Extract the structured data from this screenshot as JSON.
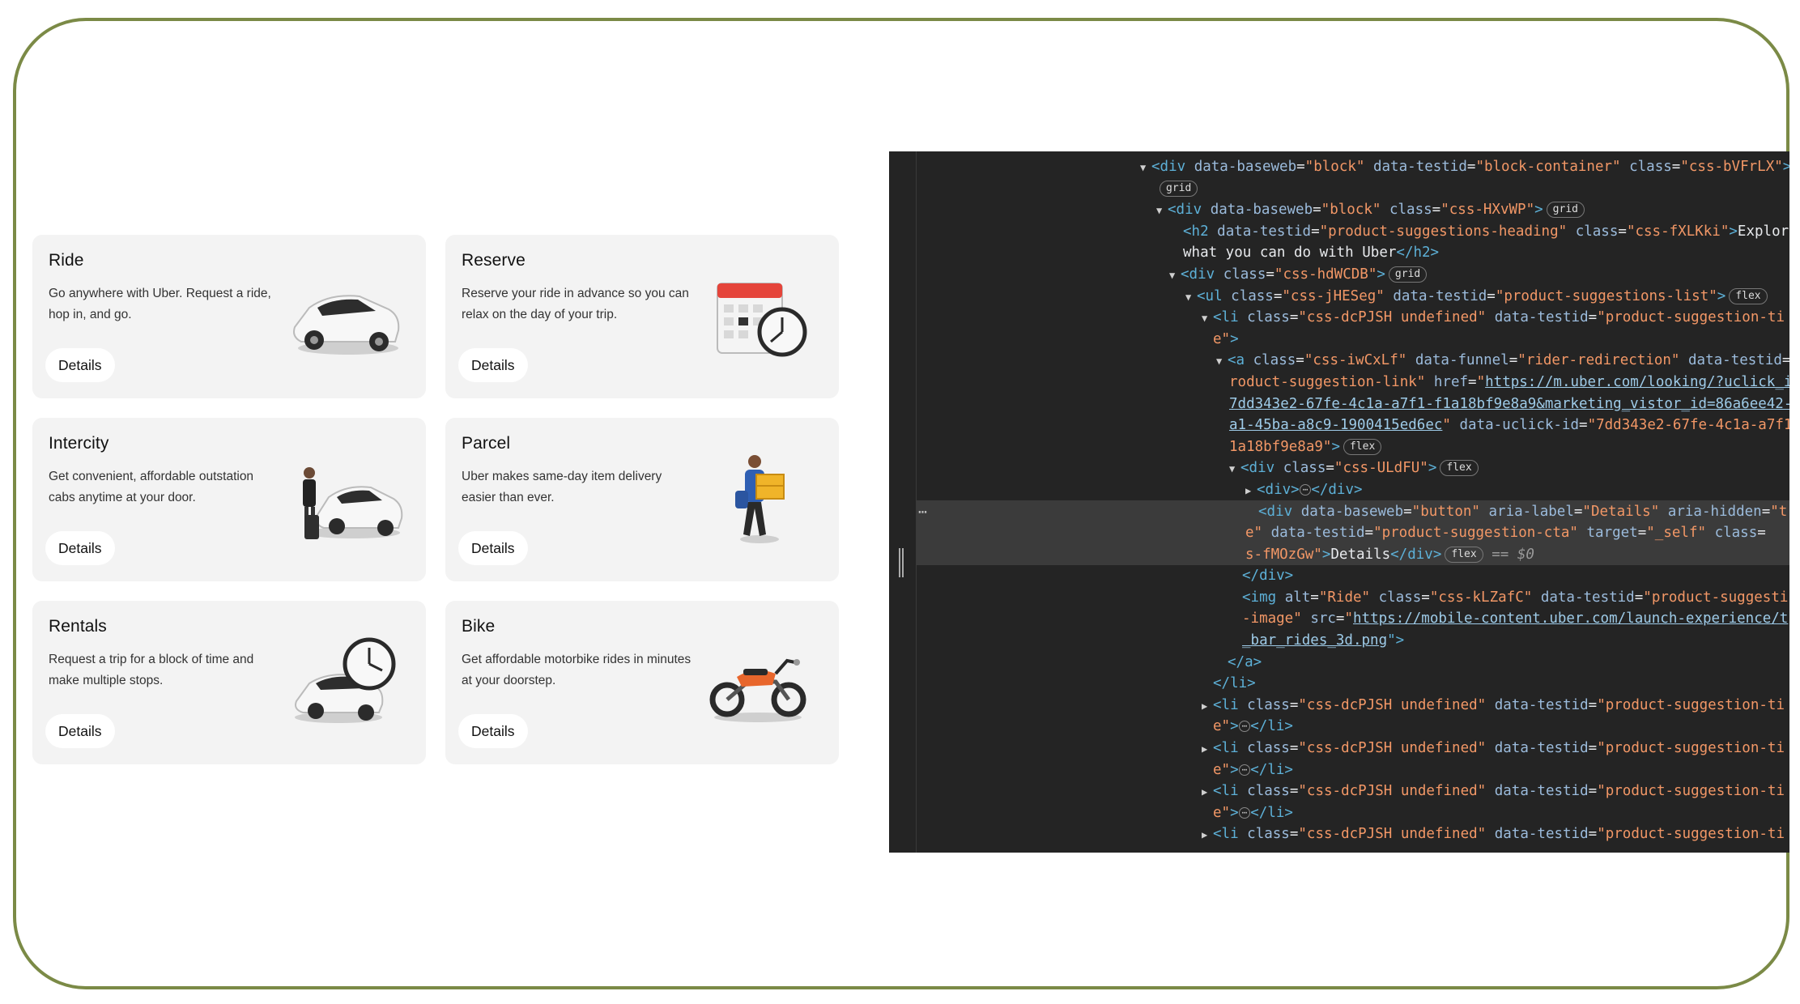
{
  "cards": [
    {
      "title": "Ride",
      "desc": "Go anywhere with Uber. Request a ride, hop in, and go.",
      "button": "Details",
      "icon": "car-icon"
    },
    {
      "title": "Reserve",
      "desc": "Reserve your ride in advance so you can relax on the day of your trip.",
      "button": "Details",
      "icon": "calendar-clock-icon"
    },
    {
      "title": "Intercity",
      "desc": "Get convenient, affordable outstation cabs anytime at your door.",
      "button": "Details",
      "icon": "traveler-car-icon"
    },
    {
      "title": "Parcel",
      "desc": "Uber makes same-day item delivery easier than ever.",
      "button": "Details",
      "icon": "courier-box-icon"
    },
    {
      "title": "Rentals",
      "desc": "Request a trip for a block of time and make multiple stops.",
      "button": "Details",
      "icon": "car-clock-icon"
    },
    {
      "title": "Bike",
      "desc": "Get affordable motorbike rides in minutes at your doorstep.",
      "button": "Details",
      "icon": "motorbike-icon"
    }
  ],
  "devtools": {
    "l1": {
      "tag_open": "<div ",
      "a1": "data-baseweb",
      "v1": "\"block\"",
      "a2": "data-testid",
      "v2": "\"block-container\"",
      "a3": "class",
      "v3": "\"css-bVFrLX\"",
      "close": ">"
    },
    "l2": {
      "badge": "grid"
    },
    "l3": {
      "tag_open": "<div ",
      "a1": "data-baseweb",
      "v1": "\"block\"",
      "a2": "class",
      "v2": "\"css-HXvWP\"",
      "close": ">",
      "badge": "grid"
    },
    "l4": {
      "tag_open": "<h2 ",
      "a1": "data-testid",
      "v1": "\"product-suggestions-heading\"",
      "a2": "class",
      "v2": "\"css-fXLKki\"",
      "close": ">",
      "text": "Explore"
    },
    "l5": {
      "text": "what you can do with Uber",
      "tag_close": "</h2>"
    },
    "l6": {
      "tag_open": "<div ",
      "a1": "class",
      "v1": "\"css-hdWCDB\"",
      "close": ">",
      "badge": "grid"
    },
    "l7": {
      "tag_open": "<ul ",
      "a1": "class",
      "v1": "\"css-jHESeg\"",
      "a2": "data-testid",
      "v2": "\"product-suggestions-list\"",
      "close": ">",
      "badge": "flex"
    },
    "l8": {
      "tag_open": "<li ",
      "a1": "class",
      "v1": "\"css-dcPJSH undefined\"",
      "a2": "data-testid",
      "v2": "\"product-suggestion-ti"
    },
    "l9": {
      "v": "e\"",
      "close": ">"
    },
    "l10": {
      "tag_open": "<a ",
      "a1": "class",
      "v1": "\"css-iwCxLf\"",
      "a2": "data-funnel",
      "v2": "\"rider-redirection\"",
      "a3": "data-testid"
    },
    "l11": {
      "v": "roduct-suggestion-link\"",
      "a1": "href",
      "link": "https://m.uber.com/looking/?uclick_i"
    },
    "l12": {
      "link": "7dd343e2-67fe-4c1a-a7f1-f1a18bf9e8a9&marketing_vistor_id=86a6ee42-"
    },
    "l13": {
      "link": "a1-45ba-a8c9-1900415ed6ec",
      "a1": "data-uclick-id",
      "v1": "\"7dd343e2-67fe-4c1a-a7f1"
    },
    "l14": {
      "v": "1a18bf9e8a9\"",
      "close": ">",
      "badge": "flex"
    },
    "l15": {
      "tag_open": "<div ",
      "a1": "class",
      "v1": "\"css-ULdFU\"",
      "close": ">",
      "badge": "flex"
    },
    "l16": {
      "tag_open": "<div>",
      "ellipsis": "⋯",
      "tag_close": "</div>"
    },
    "l17": {
      "tag_open": "<div ",
      "a1": "data-baseweb",
      "v1": "\"button\"",
      "a2": "aria-label",
      "v2": "\"Details\"",
      "a3": "aria-hidden",
      "v3": "\"t"
    },
    "l18": {
      "v": "e\"",
      "a1": "data-testid",
      "v1": "\"product-suggestion-cta\"",
      "a2": "target",
      "v2": "\"_self\"",
      "a3": "class"
    },
    "l19": {
      "v": "s-fMOzGw\"",
      "close": ">",
      "text": "Details",
      "tag_close": "</div>",
      "badge": "flex",
      "ref": "== $0"
    },
    "l20": {
      "tag_close": "</div>"
    },
    "l21": {
      "tag_open": "<img ",
      "a1": "alt",
      "v1": "\"Ride\"",
      "a2": "class",
      "v2": "\"css-kLZafC\"",
      "a3": "data-testid",
      "v3": "\"product-suggesti"
    },
    "l22": {
      "v": "-image\"",
      "a1": "src",
      "link": "https://mobile-content.uber.com/launch-experience/t"
    },
    "l23": {
      "link": "_bar_rides_3d.png",
      "close": "\">"
    },
    "l24": {
      "tag_close": "</a>"
    },
    "l25": {
      "tag_close": "</li>"
    },
    "li_collapsed": {
      "tag_open": "<li ",
      "a1": "class",
      "v1": "\"css-dcPJSH undefined\"",
      "a2": "data-testid",
      "v2": "\"product-suggestion-ti",
      "cont": "e\"",
      "close": ">",
      "ellipsis": "⋯",
      "tag_close": "</li>"
    },
    "side_dots": "⋯"
  }
}
